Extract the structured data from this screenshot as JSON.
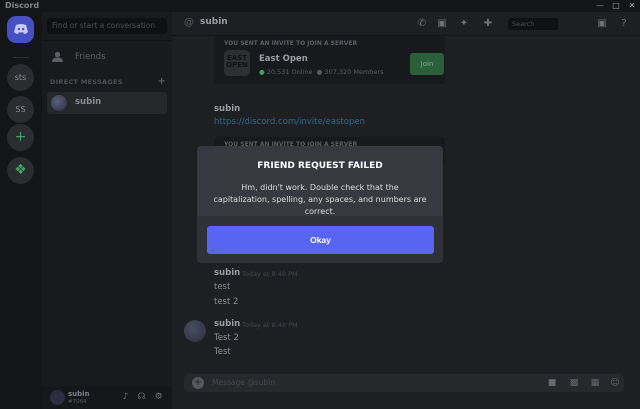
{
  "window": {
    "title": "Discord",
    "minimize_icon": "minimize-icon",
    "maximize_icon": "maximize-icon",
    "close_icon": "close-icon"
  },
  "rail": {
    "servers": [
      "sts",
      "SS"
    ]
  },
  "sidebar": {
    "search_placeholder": "Find or start a conversation",
    "friends_label": "Friends",
    "dm_header": "DIRECT MESSAGES",
    "dms": [
      {
        "name": "subin"
      }
    ]
  },
  "user": {
    "name": "subin",
    "tag": "#7064"
  },
  "chat": {
    "header_title": "subin",
    "search_placeholder": "Search"
  },
  "invites": [
    {
      "caption": "YOU SENT AN INVITE TO JOIN A SERVER",
      "server": "East Open",
      "logo": "EAST OPEN",
      "online": "20,531 Online",
      "members": "307,320 Members",
      "join_label": "Join"
    },
    {
      "caption": "YOU SENT AN INVITE TO JOIN A SERVER"
    }
  ],
  "messages": [
    {
      "author": "subin",
      "link": "https://discord.com/invite/eastopen"
    },
    {
      "author": "subin",
      "time": "Today at 8:48 PM",
      "lines": [
        "test",
        "test 2"
      ]
    },
    {
      "author": "subin",
      "time": "Today at 8:48 PM",
      "lines": [
        "Test 2",
        "Test"
      ]
    }
  ],
  "composer": {
    "placeholder": "Message @subin"
  },
  "modal": {
    "title": "FRIEND REQUEST FAILED",
    "body": "Hm, didn't work. Double check that the capitalization, spelling, any spaces, and numbers are correct.",
    "button": "Okay"
  },
  "colors": {
    "blurple": "#5865f2",
    "modal_bg": "#36393f",
    "modal_footer": "#2f3136"
  }
}
